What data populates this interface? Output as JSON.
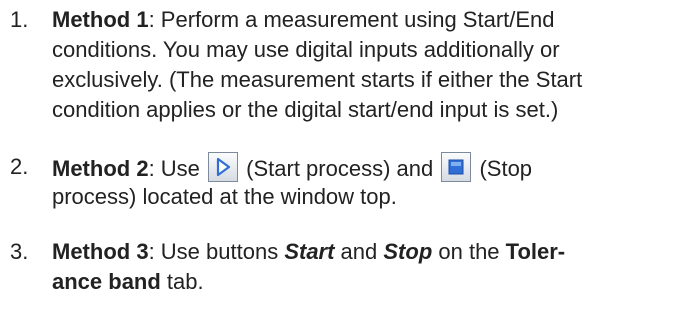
{
  "steps": [
    {
      "number": "1.",
      "title": "Method 1",
      "lines": [
        ": Perform a measurement using Start/End",
        "conditions. You may use digital inputs additionally or",
        "exclusively. (The measurement starts if either the Start",
        "condition applies or the digital start/end input is set.)"
      ]
    },
    {
      "number": "2.",
      "title": "Method 2",
      "use_text": ": Use ",
      "start_caption": " (Start process) and ",
      "stop_caption": " (Stop",
      "line2": "process) located at the window top.",
      "start_icon": "play-triangle-icon",
      "stop_icon": "stop-square-icon"
    },
    {
      "number": "3.",
      "title": "Method 3",
      "text_a": ": Use buttons ",
      "start_label": "Start",
      "text_b": " and ",
      "stop_label": "Stop",
      "text_c": " on the ",
      "tab_name_part1": "Toler-",
      "tab_name_part2": "ance band",
      "text_d": " tab."
    }
  ],
  "colors": {
    "text": "#222222",
    "icon_blue": "#2f6fd6",
    "icon_border": "#7d8a9c"
  }
}
